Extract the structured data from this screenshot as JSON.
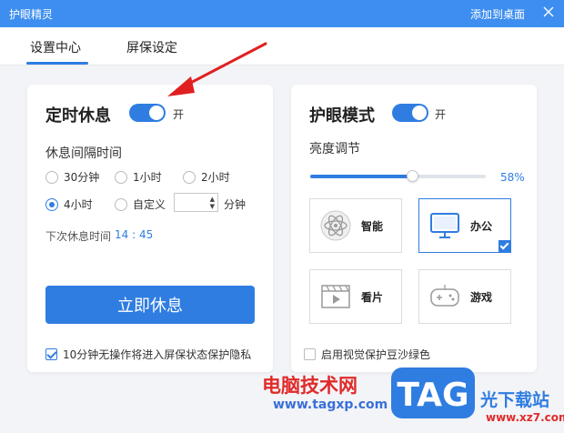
{
  "titlebar": {
    "title": "护眼精灵",
    "add_desktop": "添加到桌面"
  },
  "tabs": [
    {
      "label": "设置中心",
      "active": true
    },
    {
      "label": "屏保设定",
      "active": false
    }
  ],
  "rest": {
    "heading": "定时休息",
    "toggle_on": true,
    "toggle_label": "开",
    "interval_label": "休息间隔时间",
    "options": [
      {
        "label": "30分钟",
        "checked": false
      },
      {
        "label": "1小时",
        "checked": false
      },
      {
        "label": "2小时",
        "checked": false
      },
      {
        "label": "4小时",
        "checked": true
      },
      {
        "label": "自定义",
        "checked": false
      }
    ],
    "custom_value": "",
    "custom_unit": "分钟",
    "next_rest_label": "下次休息时间",
    "next_rest_time": "14 : 45",
    "rest_button": "立即休息",
    "idle_screensaver_checked": true,
    "idle_screensaver_label": "10分钟无操作将进入屏保状态保护隐私"
  },
  "eye": {
    "heading": "护眼模式",
    "toggle_on": true,
    "toggle_label": "开",
    "brightness_label": "亮度调节",
    "brightness_percent": 58,
    "brightness_text": "58%",
    "modes": [
      {
        "label": "智能",
        "icon": "atom-icon",
        "selected": false
      },
      {
        "label": "办公",
        "icon": "monitor-icon",
        "selected": true
      },
      {
        "label": "看片",
        "icon": "film-icon",
        "selected": false
      },
      {
        "label": "游戏",
        "icon": "gamepad-icon",
        "selected": false
      }
    ],
    "green_checked": false,
    "green_label": "启用视觉保护豆沙绿色"
  },
  "watermark": {
    "cn": "电脑技术网",
    "url": "www.tagxp.com",
    "logo": "TAG",
    "site": "光下载站",
    "url2": "www.xz7.com"
  },
  "colors": {
    "accent": "#2f7de1",
    "titlebar": "#3d8ef0",
    "arrow": "#e02020"
  }
}
